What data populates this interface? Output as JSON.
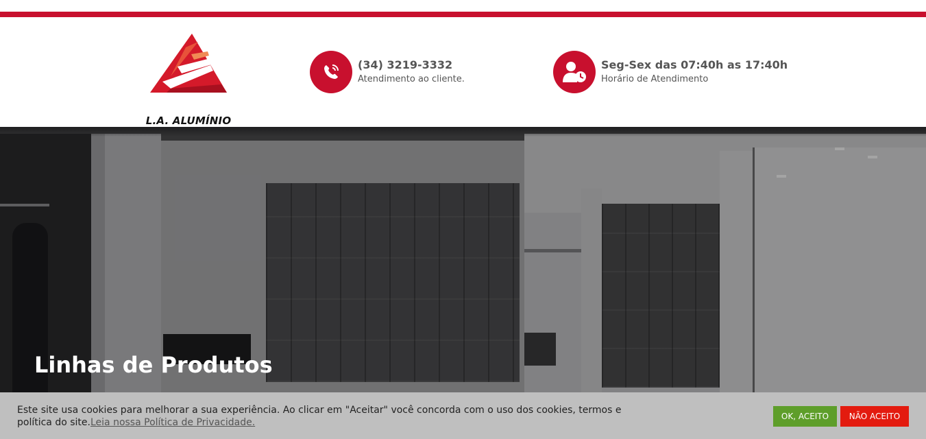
{
  "brand": {
    "name": "L.A. ALUMÍNIO",
    "logo_icon": "triangle-logo-icon",
    "accent_color": "#c8102e"
  },
  "header": {
    "phone": {
      "icon": "phone-icon",
      "number": "(34) 3219-3332",
      "caption": "Atendimento ao cliente."
    },
    "hours": {
      "icon": "user-clock-icon",
      "schedule": "Seg-Sex das 07:40h as 17:40h",
      "caption": "Horário de Atendimento"
    }
  },
  "hero": {
    "title": "Linhas de Produtos"
  },
  "cookie_notice": {
    "text": "Este site usa cookies para melhorar a sua experiência. Ao clicar em \"Aceitar\" você concorda com o uso dos cookies, termos e política do site.",
    "link_label": "Leia nossa Política de Privacidade.",
    "accept_label": "OK, ACEITO",
    "reject_label": "NÃO ACEITO",
    "accept_color": "#5e9e2a",
    "reject_color": "#e31b0f"
  }
}
